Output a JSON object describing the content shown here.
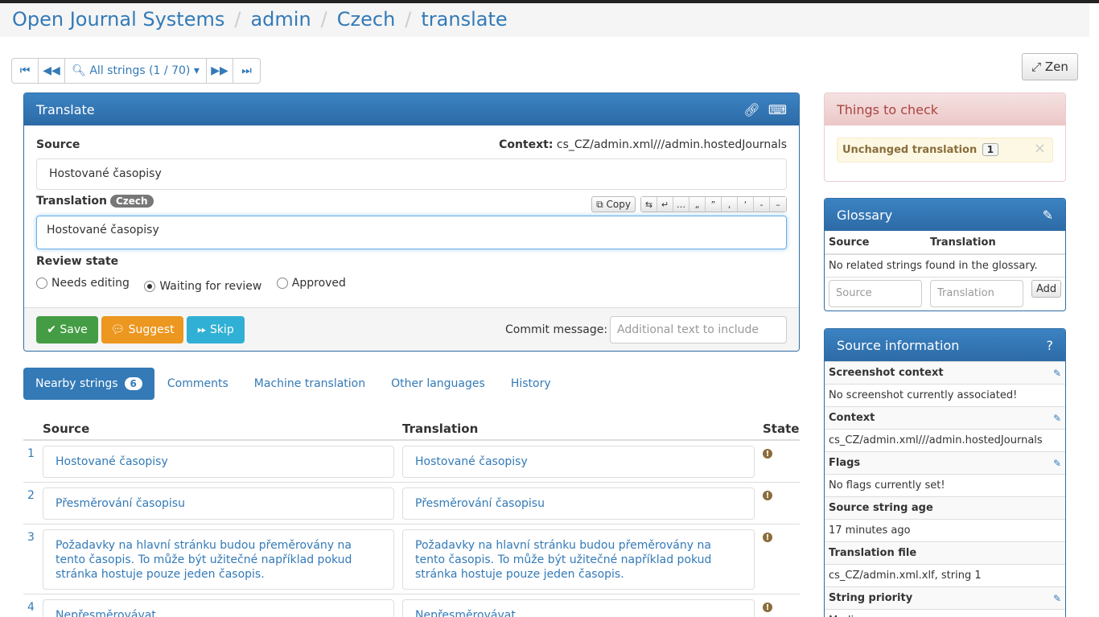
{
  "breadcrumb": [
    "Open Journal Systems",
    "admin",
    "Czech",
    "translate"
  ],
  "nav": {
    "filter_label": "All strings (1 / 70)"
  },
  "zen_label": "Zen",
  "translate_panel": {
    "title": "Translate",
    "source_label": "Source",
    "context_label": "Context:",
    "context_value": "cs_CZ/admin.xml///admin.hostedJournals",
    "source_text": "Hostované časopisy",
    "translation_label": "Translation",
    "language_badge": "Czech",
    "copy_label": "Copy",
    "special_chars": [
      "⇆",
      "↵",
      "…",
      "„",
      "”",
      "‚",
      "‘",
      "-",
      "–"
    ],
    "translation_text": "Hostované časopisy",
    "review_label": "Review state",
    "review_options": [
      "Needs editing",
      "Waiting for review",
      "Approved"
    ],
    "review_selected": "Waiting for review",
    "save_label": "Save",
    "suggest_label": "Suggest",
    "skip_label": "Skip",
    "commit_label": "Commit message:",
    "commit_placeholder": "Additional text to include"
  },
  "tabs": [
    {
      "label": "Nearby strings",
      "count": "6"
    },
    {
      "label": "Comments"
    },
    {
      "label": "Machine translation"
    },
    {
      "label": "Other languages"
    },
    {
      "label": "History"
    }
  ],
  "nearby": {
    "headers": [
      "Source",
      "Translation",
      "State"
    ],
    "rows": [
      {
        "num": "1",
        "source": "Hostované časopisy",
        "translation": "Hostované časopisy"
      },
      {
        "num": "2",
        "source": "Přesměrování časopisu",
        "translation": "Přesměrování časopisu"
      },
      {
        "num": "3",
        "source": "Požadavky na hlavní stránku budou přeměrovány na tento časopis. To může být užitečné například pokud stránka hostuje pouze jeden časopis.",
        "translation": "Požadavky na hlavní stránku budou přeměrovány na tento časopis. To může být užitečné například pokud stránka hostuje pouze jeden časopis."
      },
      {
        "num": "4",
        "source": "Nepřesměrovávat",
        "translation": "Nepřesměrovávat"
      }
    ]
  },
  "checks": {
    "title": "Things to check",
    "item": "Unchanged translation",
    "count": "1"
  },
  "glossary": {
    "title": "Glossary",
    "col_source": "Source",
    "col_translation": "Translation",
    "empty": "No related strings found in the glossary.",
    "source_placeholder": "Source",
    "translation_placeholder": "Translation",
    "add_label": "Add"
  },
  "source_info": {
    "title": "Source information",
    "rows": [
      {
        "label": "Screenshot context",
        "value": "No screenshot currently associated!"
      },
      {
        "label": "Context",
        "value": "cs_CZ/admin.xml///admin.hostedJournals"
      },
      {
        "label": "Flags",
        "value": "No flags currently set!"
      },
      {
        "label": "Source string age",
        "value": "17 minutes ago"
      },
      {
        "label": "Translation file",
        "value": "cs_CZ/admin.xml.xlf, string 1"
      },
      {
        "label": "String priority",
        "value": "Medium"
      }
    ]
  }
}
